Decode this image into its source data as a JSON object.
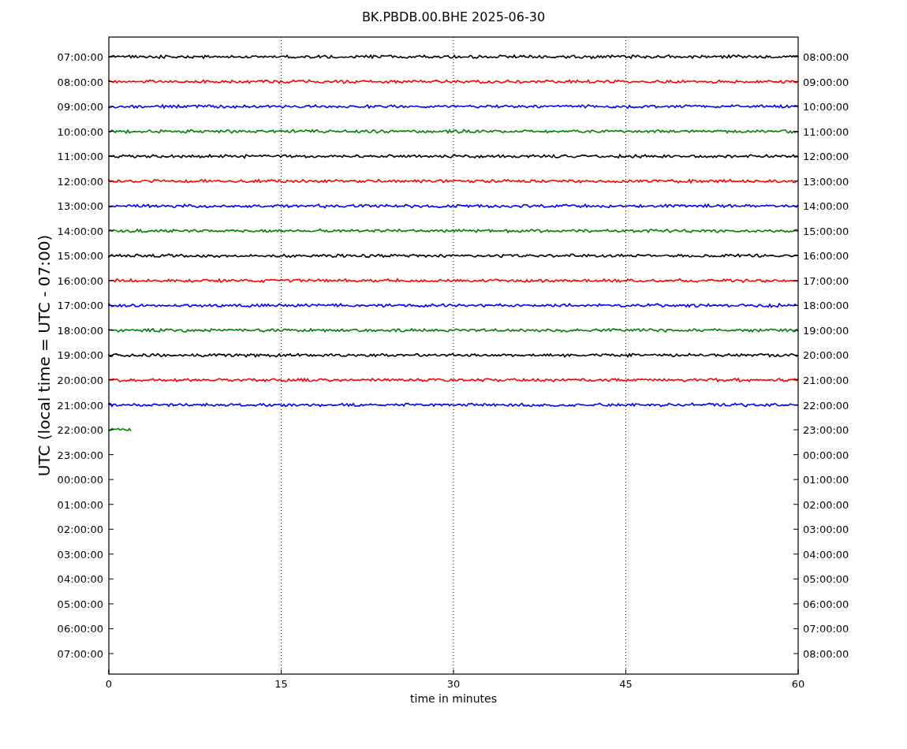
{
  "title": "BK.PBDB.00.BHE 2025-06-30",
  "ylabel": "UTC (local time = UTC - 07:00)",
  "xlabel": "time in minutes",
  "xticks": [
    "0",
    "15",
    "30",
    "45",
    "60"
  ],
  "left_labels": [
    "07:00:00",
    "08:00:00",
    "09:00:00",
    "10:00:00",
    "11:00:00",
    "12:00:00",
    "13:00:00",
    "14:00:00",
    "15:00:00",
    "16:00:00",
    "17:00:00",
    "18:00:00",
    "19:00:00",
    "20:00:00",
    "21:00:00",
    "22:00:00",
    "23:00:00",
    "00:00:00",
    "01:00:00",
    "02:00:00",
    "03:00:00",
    "04:00:00",
    "05:00:00",
    "06:00:00",
    "07:00:00"
  ],
  "right_labels": [
    "08:00:00",
    "09:00:00",
    "10:00:00",
    "11:00:00",
    "12:00:00",
    "13:00:00",
    "14:00:00",
    "15:00:00",
    "16:00:00",
    "17:00:00",
    "18:00:00",
    "19:00:00",
    "20:00:00",
    "21:00:00",
    "22:00:00",
    "23:00:00",
    "00:00:00",
    "01:00:00",
    "02:00:00",
    "03:00:00",
    "04:00:00",
    "05:00:00",
    "06:00:00",
    "07:00:00",
    "08:00:00"
  ],
  "traces": [
    {
      "color": "#000000",
      "level": 1
    },
    {
      "color": "#ff0000",
      "level": 1
    },
    {
      "color": "#0000ff",
      "level": 1
    },
    {
      "color": "#008000",
      "level": 1
    },
    {
      "color": "#000000",
      "level": 1
    },
    {
      "color": "#ff0000",
      "level": 1
    },
    {
      "color": "#0000ff",
      "level": 1
    },
    {
      "color": "#008000",
      "level": 1
    },
    {
      "color": "#000000",
      "level": 1
    },
    {
      "color": "#ff0000",
      "level": 1
    },
    {
      "color": "#0000ff",
      "level": 1
    },
    {
      "color": "#008000",
      "level": 1
    },
    {
      "color": "#000000",
      "level": 1
    },
    {
      "color": "#ff0000",
      "level": 1
    },
    {
      "color": "#0000ff",
      "level": 1
    },
    {
      "color": "#008000",
      "level": 0.034
    }
  ]
}
